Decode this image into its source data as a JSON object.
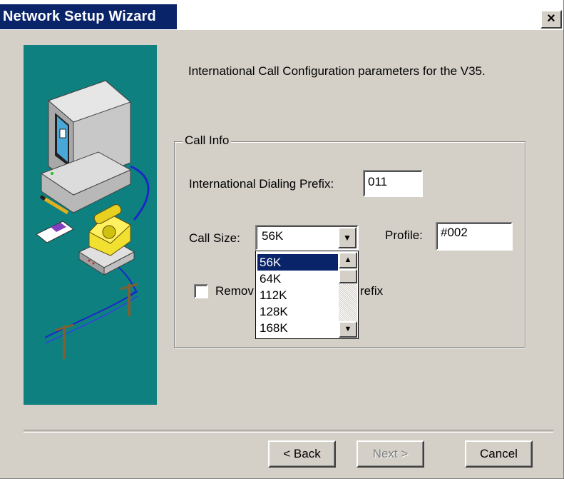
{
  "window": {
    "title": "Network Setup Wizard",
    "close_glyph": "×"
  },
  "intro_text": "International Call Configuration parameters for the V35.",
  "call_info": {
    "group_label": "Call Info",
    "dialing_prefix_label": "International Dialing Prefix:",
    "dialing_prefix_value": "011",
    "call_size_label": "Call Size:",
    "call_size_value": "56K",
    "call_size_options": [
      "56K",
      "64K",
      "112K",
      "128K",
      "168K"
    ],
    "call_size_selected": "56K",
    "profile_label": "Profile:",
    "profile_value": "#002",
    "remove_prefix_label_visible_start": "Remov",
    "remove_prefix_label_visible_end": "refix",
    "remove_prefix_checked": false
  },
  "buttons": {
    "back": "< Back",
    "next": "Next >",
    "cancel": "Cancel"
  },
  "colors": {
    "title_bar": "#0a246a",
    "art_background": "#0f8080",
    "dialog_face": "#d4d0c8",
    "selection": "#0a246a"
  },
  "icons": [
    "computer-icon",
    "telephone-icon",
    "modem-icon",
    "pencil-icon",
    "notepad-icon",
    "telephone-pole-icon"
  ]
}
